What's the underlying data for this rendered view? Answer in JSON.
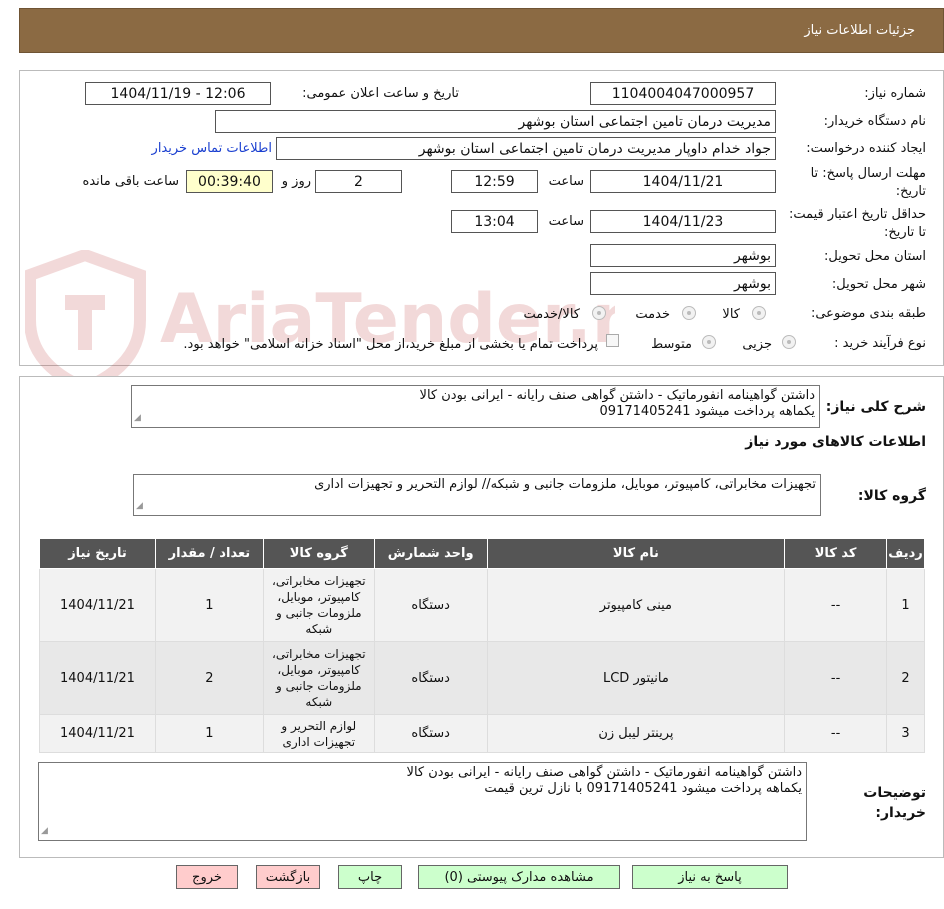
{
  "header": {
    "title": "جزئیات اطلاعات نیاز"
  },
  "watermark": {
    "text": "AriaTender.neT"
  },
  "form": {
    "need_no_label": "شماره نیاز:",
    "need_no": "1104004047000957",
    "announce_label": "تاریخ و ساعت اعلان عمومی:",
    "announce_value": "1404/11/19 - 12:06",
    "buyer_org_label": "نام دستگاه خریدار:",
    "buyer_org": "مدیریت درمان تامین اجتماعی استان بوشهر",
    "creator_label": "ایجاد کننده درخواست:",
    "creator": "جواد خدام داوپار مدیریت درمان تامین اجتماعی استان بوشهر",
    "contact_link": "اطلاعات تماس خریدار",
    "deadline_label": "مهلت ارسال پاسخ: تا تاریخ:",
    "deadline_date": "1404/11/21",
    "time_label": "ساعت",
    "deadline_time": "12:59",
    "days": "2",
    "days_label": "روز و",
    "remaining": "00:39:40",
    "remaining_label": "ساعت باقی مانده",
    "validity_label": "حداقل تاریخ اعتبار قیمت: تا تاریخ:",
    "validity_date": "1404/11/23",
    "validity_time": "13:04",
    "province_label": "استان محل تحویل:",
    "province": "بوشهر",
    "city_label": "شهر محل تحویل:",
    "city": "بوشهر",
    "category_label": "طبقه بندی موضوعی:",
    "cat_goods": "کالا",
    "cat_service": "خدمت",
    "cat_both": "کالا/خدمت",
    "process_label": "نوع فرآیند خرید :",
    "proc_partial": "جزیی",
    "proc_medium": "متوسط",
    "payment_note": "پرداخت تمام یا بخشی از مبلغ خرید،از محل \"اسناد خزانه اسلامی\" خواهد بود."
  },
  "summary": {
    "label": "شرح کلی نیاز:",
    "line1": "داشتن گواهینامه انفورماتیک - داشتن گواهی صنف رایانه - ایرانی بودن کالا",
    "line2": "یکماهه پرداخت میشود 09171405241"
  },
  "goods": {
    "section_title": "اطلاعات کالاهای مورد نیاز",
    "group_label": "گروه کالا:",
    "group_value": "تجهیزات مخابراتی، کامپیوتر، موبایل، ملزومات جانبی و شبکه// لوازم التحریر و تجهیزات اداری"
  },
  "table": {
    "headers": [
      "ردیف",
      "کد کالا",
      "نام کالا",
      "واحد شمارش",
      "گروه کالا",
      "تعداد / مقدار",
      "تاریخ نیاز"
    ],
    "rows": [
      [
        "1",
        "--",
        "مینی کامپیوتر",
        "دستگاه",
        "تجهیزات مخابراتی، کامپیوتر، موبایل، ملزومات جانبی و شبکه",
        "1",
        "1404/11/21"
      ],
      [
        "2",
        "--",
        "مانیتور LCD",
        "دستگاه",
        "تجهیزات مخابراتی، کامپیوتر، موبایل، ملزومات جانبی و شبکه",
        "2",
        "1404/11/21"
      ],
      [
        "3",
        "--",
        "پرینتر لیبل زن",
        "دستگاه",
        "لوازم التحریر و تجهیزات اداری",
        "1",
        "1404/11/21"
      ]
    ]
  },
  "notes": {
    "label_line1": "توضیحات",
    "label_line2": "خریدار:",
    "line1": "داشتن گواهینامه انفورماتیک - داشتن گواهی صنف رایانه - ایرانی بودن کالا",
    "line2": "یکماهه پرداخت میشود 09171405241 با نازل ترین قیمت"
  },
  "buttons": {
    "reply": "پاسخ به نیاز",
    "attachments": "مشاهده مدارک پیوستی (0)",
    "print": "چاپ",
    "back": "بازگشت",
    "exit": "خروج"
  },
  "colors": {
    "header": "#8b6a43",
    "link": "#1a3fd0",
    "table_header": "#555555",
    "highlight": "#ffffcc",
    "green_btn": "#ccffcc",
    "pink_btn": "#ffcccc"
  }
}
